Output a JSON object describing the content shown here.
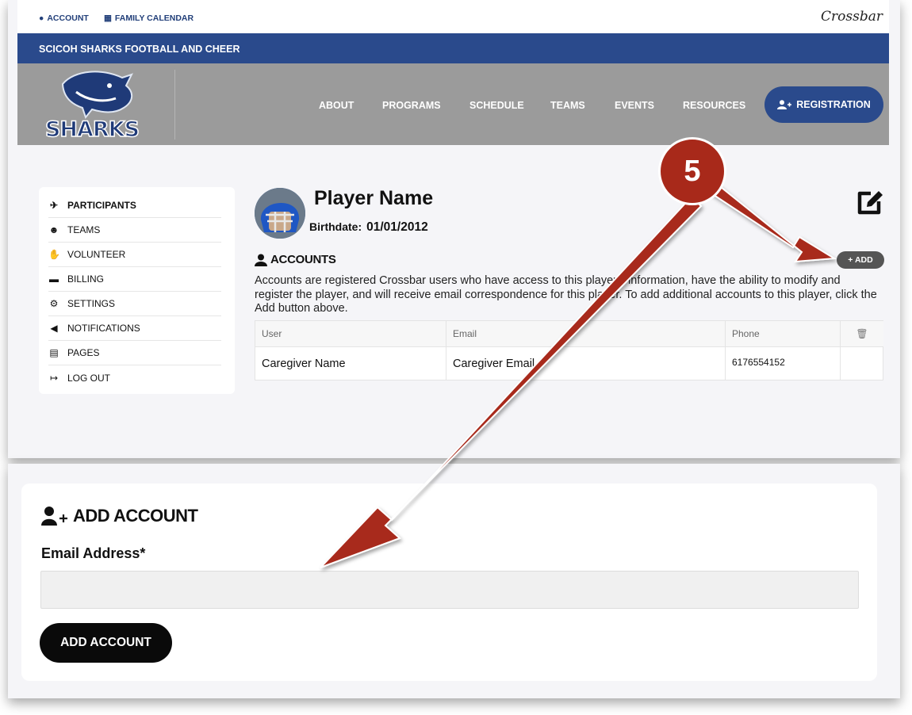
{
  "topbar": {
    "account_label": "ACCOUNT",
    "calendar_label": "FAMILY CALENDAR",
    "brand": "Crossbar"
  },
  "org": {
    "name": "SCICOH SHARKS FOOTBALL AND CHEER",
    "logo_text": "SHARKS"
  },
  "nav": {
    "items": [
      "ABOUT",
      "PROGRAMS",
      "SCHEDULE",
      "TEAMS",
      "EVENTS",
      "RESOURCES"
    ],
    "registration_label": "REGISTRATION"
  },
  "sidebar": {
    "items": [
      {
        "label": "PARTICIPANTS",
        "icon": "running-icon"
      },
      {
        "label": "TEAMS",
        "icon": "users-icon"
      },
      {
        "label": "VOLUNTEER",
        "icon": "handshake-icon"
      },
      {
        "label": "BILLING",
        "icon": "credit-card-icon"
      },
      {
        "label": "SETTINGS",
        "icon": "cogs-icon"
      },
      {
        "label": "NOTIFICATIONS",
        "icon": "megaphone-icon"
      },
      {
        "label": "PAGES",
        "icon": "file-icon"
      },
      {
        "label": "LOG OUT",
        "icon": "sign-out-icon"
      }
    ]
  },
  "player": {
    "name": "Player Name",
    "birthdate_label": "Birthdate:",
    "birthdate": "01/01/2012"
  },
  "accounts": {
    "title": "ACCOUNTS",
    "add_label": "+ ADD",
    "description": "Accounts are registered Crossbar users who have access to this player's information, have the ability to modify and register the player, and will receive email correspondence for this player. To add additional accounts to this player, click the Add button above.",
    "columns": [
      "User",
      "Email",
      "Phone"
    ],
    "rows": [
      {
        "user": "Caregiver Name",
        "email": "Caregiver Email",
        "phone": "6176554152"
      }
    ]
  },
  "add_account": {
    "title": "ADD ACCOUNT",
    "email_label": "Email Address*",
    "email_value": "",
    "button_label": "ADD ACCOUNT"
  },
  "annotation": {
    "step": "5",
    "color": "#a8291a"
  },
  "colors": {
    "primary": "#2a4a8c",
    "hero": "#9b9b9b"
  }
}
